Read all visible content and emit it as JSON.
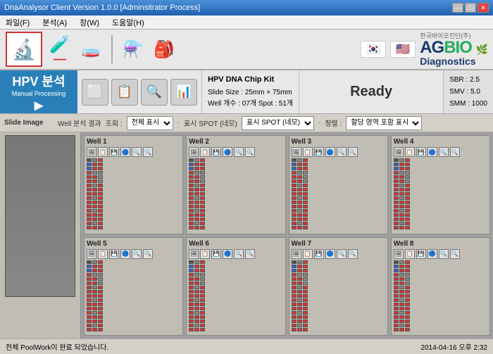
{
  "titleBar": {
    "title": "DnaAnalysor Client Version 1.0.0 [Adminsitrator Process]",
    "minBtn": "—",
    "maxBtn": "□",
    "closeBtn": "✕"
  },
  "menuBar": {
    "items": [
      "파일(F)",
      "분석(A)",
      "창(W)",
      "도움말(H)"
    ]
  },
  "toolbar": {
    "icons": [
      "microscope",
      "tubes",
      "flasks",
      "bag"
    ]
  },
  "logo": {
    "topText": "한국바이오진단(주)",
    "ag": "AG",
    "bio": "BIO",
    "diagnostics": "Diagnostics"
  },
  "hpv": {
    "title": "HPV 분석",
    "subtitle": "Manual Processing",
    "chipKit": "HPV DNA Chip Kit",
    "slideSize": "Slide Size : 25mm × 75mm",
    "wellCount": "Well 개수 : 07개   Spot : 51개",
    "readyLabel": "Ready",
    "sbr": "SBR : 2.5",
    "smv": "SMV : 5.0",
    "smm": "SMM : 1000"
  },
  "controls": {
    "analysisResultLabel": "Well 분석 결과",
    "conditionLabel": "조회 :",
    "conditionOptions": [
      "전체 표시"
    ],
    "displayLabel": "표시 SPOT (네모)",
    "displayOptions": [
      "표시 SPOT (네모)"
    ],
    "sortLabel": "정렬 :",
    "sortOptions": [
      "할당 영역 포함 표시"
    ]
  },
  "slidePanel": {
    "header": "Slide Image"
  },
  "wells": [
    {
      "id": "well1",
      "label": "Well 1"
    },
    {
      "id": "well2",
      "label": "Well 2"
    },
    {
      "id": "well3",
      "label": "Well 3"
    },
    {
      "id": "well4",
      "label": "Well 4"
    },
    {
      "id": "well5",
      "label": "Well 5"
    },
    {
      "id": "well6",
      "label": "Well 6"
    },
    {
      "id": "well7",
      "label": "Well 7"
    },
    {
      "id": "well8",
      "label": "Well 8"
    }
  ],
  "statusBar": {
    "message": "전체 PoolWork이 완료 되었습니다.",
    "datetime": "2014-04-16 오후 2:32"
  }
}
